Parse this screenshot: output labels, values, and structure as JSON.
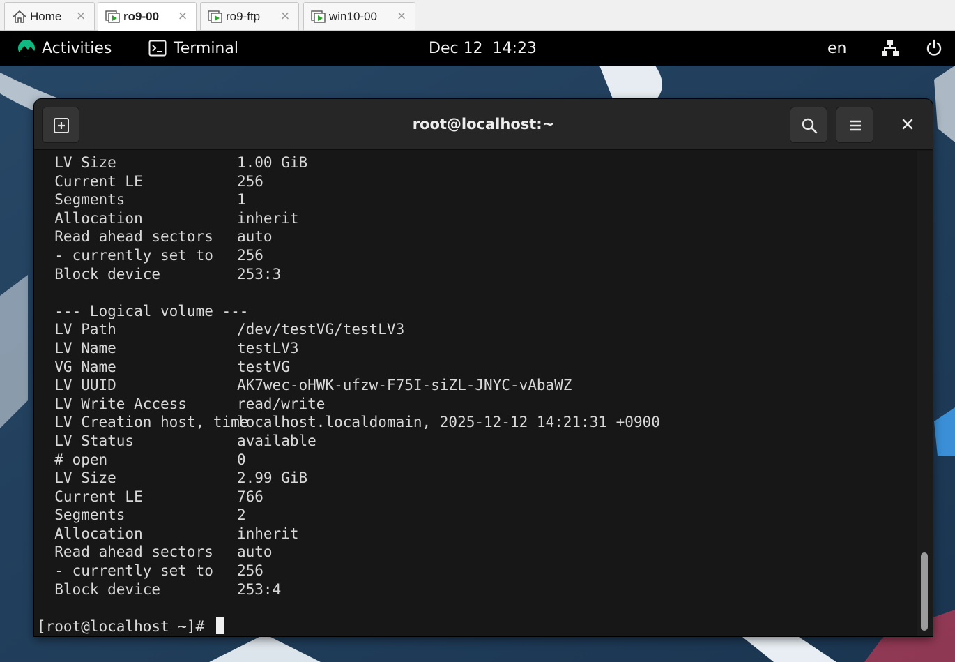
{
  "vm_tabs": [
    {
      "label": "Home",
      "icon": "home-icon",
      "active": false
    },
    {
      "label": "ro9-00",
      "icon": "vm-running-icon",
      "active": true
    },
    {
      "label": "ro9-ftp",
      "icon": "vm-running-icon",
      "active": false
    },
    {
      "label": "win10-00",
      "icon": "vm-running-icon",
      "active": false
    }
  ],
  "topbar": {
    "activities": "Activities",
    "app_name": "Terminal",
    "clock": "Dec 12  14:23",
    "keyboard_layout": "en",
    "network_icon": "network-wired-icon",
    "power_icon": "power-icon"
  },
  "terminal": {
    "title": "root@localhost:~",
    "new_tab_icon": "new-tab-icon",
    "search_icon": "search-icon",
    "menu_icon": "hamburger-menu-icon",
    "close_icon": "close-icon",
    "lines": [
      {
        "key": "  LV Size",
        "value": "1.00 GiB"
      },
      {
        "key": "  Current LE",
        "value": "256"
      },
      {
        "key": "  Segments",
        "value": "1"
      },
      {
        "key": "  Allocation",
        "value": "inherit"
      },
      {
        "key": "  Read ahead sectors",
        "value": "auto"
      },
      {
        "key": "  - currently set to",
        "value": "256"
      },
      {
        "key": "  Block device",
        "value": "253:3"
      },
      {
        "key": "",
        "value": ""
      },
      {
        "key": "  --- Logical volume ---",
        "value": ""
      },
      {
        "key": "  LV Path",
        "value": "/dev/testVG/testLV3"
      },
      {
        "key": "  LV Name",
        "value": "testLV3"
      },
      {
        "key": "  VG Name",
        "value": "testVG"
      },
      {
        "key": "  LV UUID",
        "value": "AK7wec-oHWK-ufzw-F75I-siZL-JNYC-vAbaWZ"
      },
      {
        "key": "  LV Write Access",
        "value": "read/write"
      },
      {
        "key": "  LV Creation host, time",
        "value": "localhost.localdomain, 2025-12-12 14:21:31 +0900"
      },
      {
        "key": "  LV Status",
        "value": "available"
      },
      {
        "key": "  # open",
        "value": "0"
      },
      {
        "key": "  LV Size",
        "value": "2.99 GiB"
      },
      {
        "key": "  Current LE",
        "value": "766"
      },
      {
        "key": "  Segments",
        "value": "2"
      },
      {
        "key": "  Allocation",
        "value": "inherit"
      },
      {
        "key": "  Read ahead sectors",
        "value": "auto"
      },
      {
        "key": "  - currently set to",
        "value": "256"
      },
      {
        "key": "  Block device",
        "value": "253:4"
      },
      {
        "key": "",
        "value": ""
      }
    ],
    "prompt": "[root@localhost ~]# "
  }
}
